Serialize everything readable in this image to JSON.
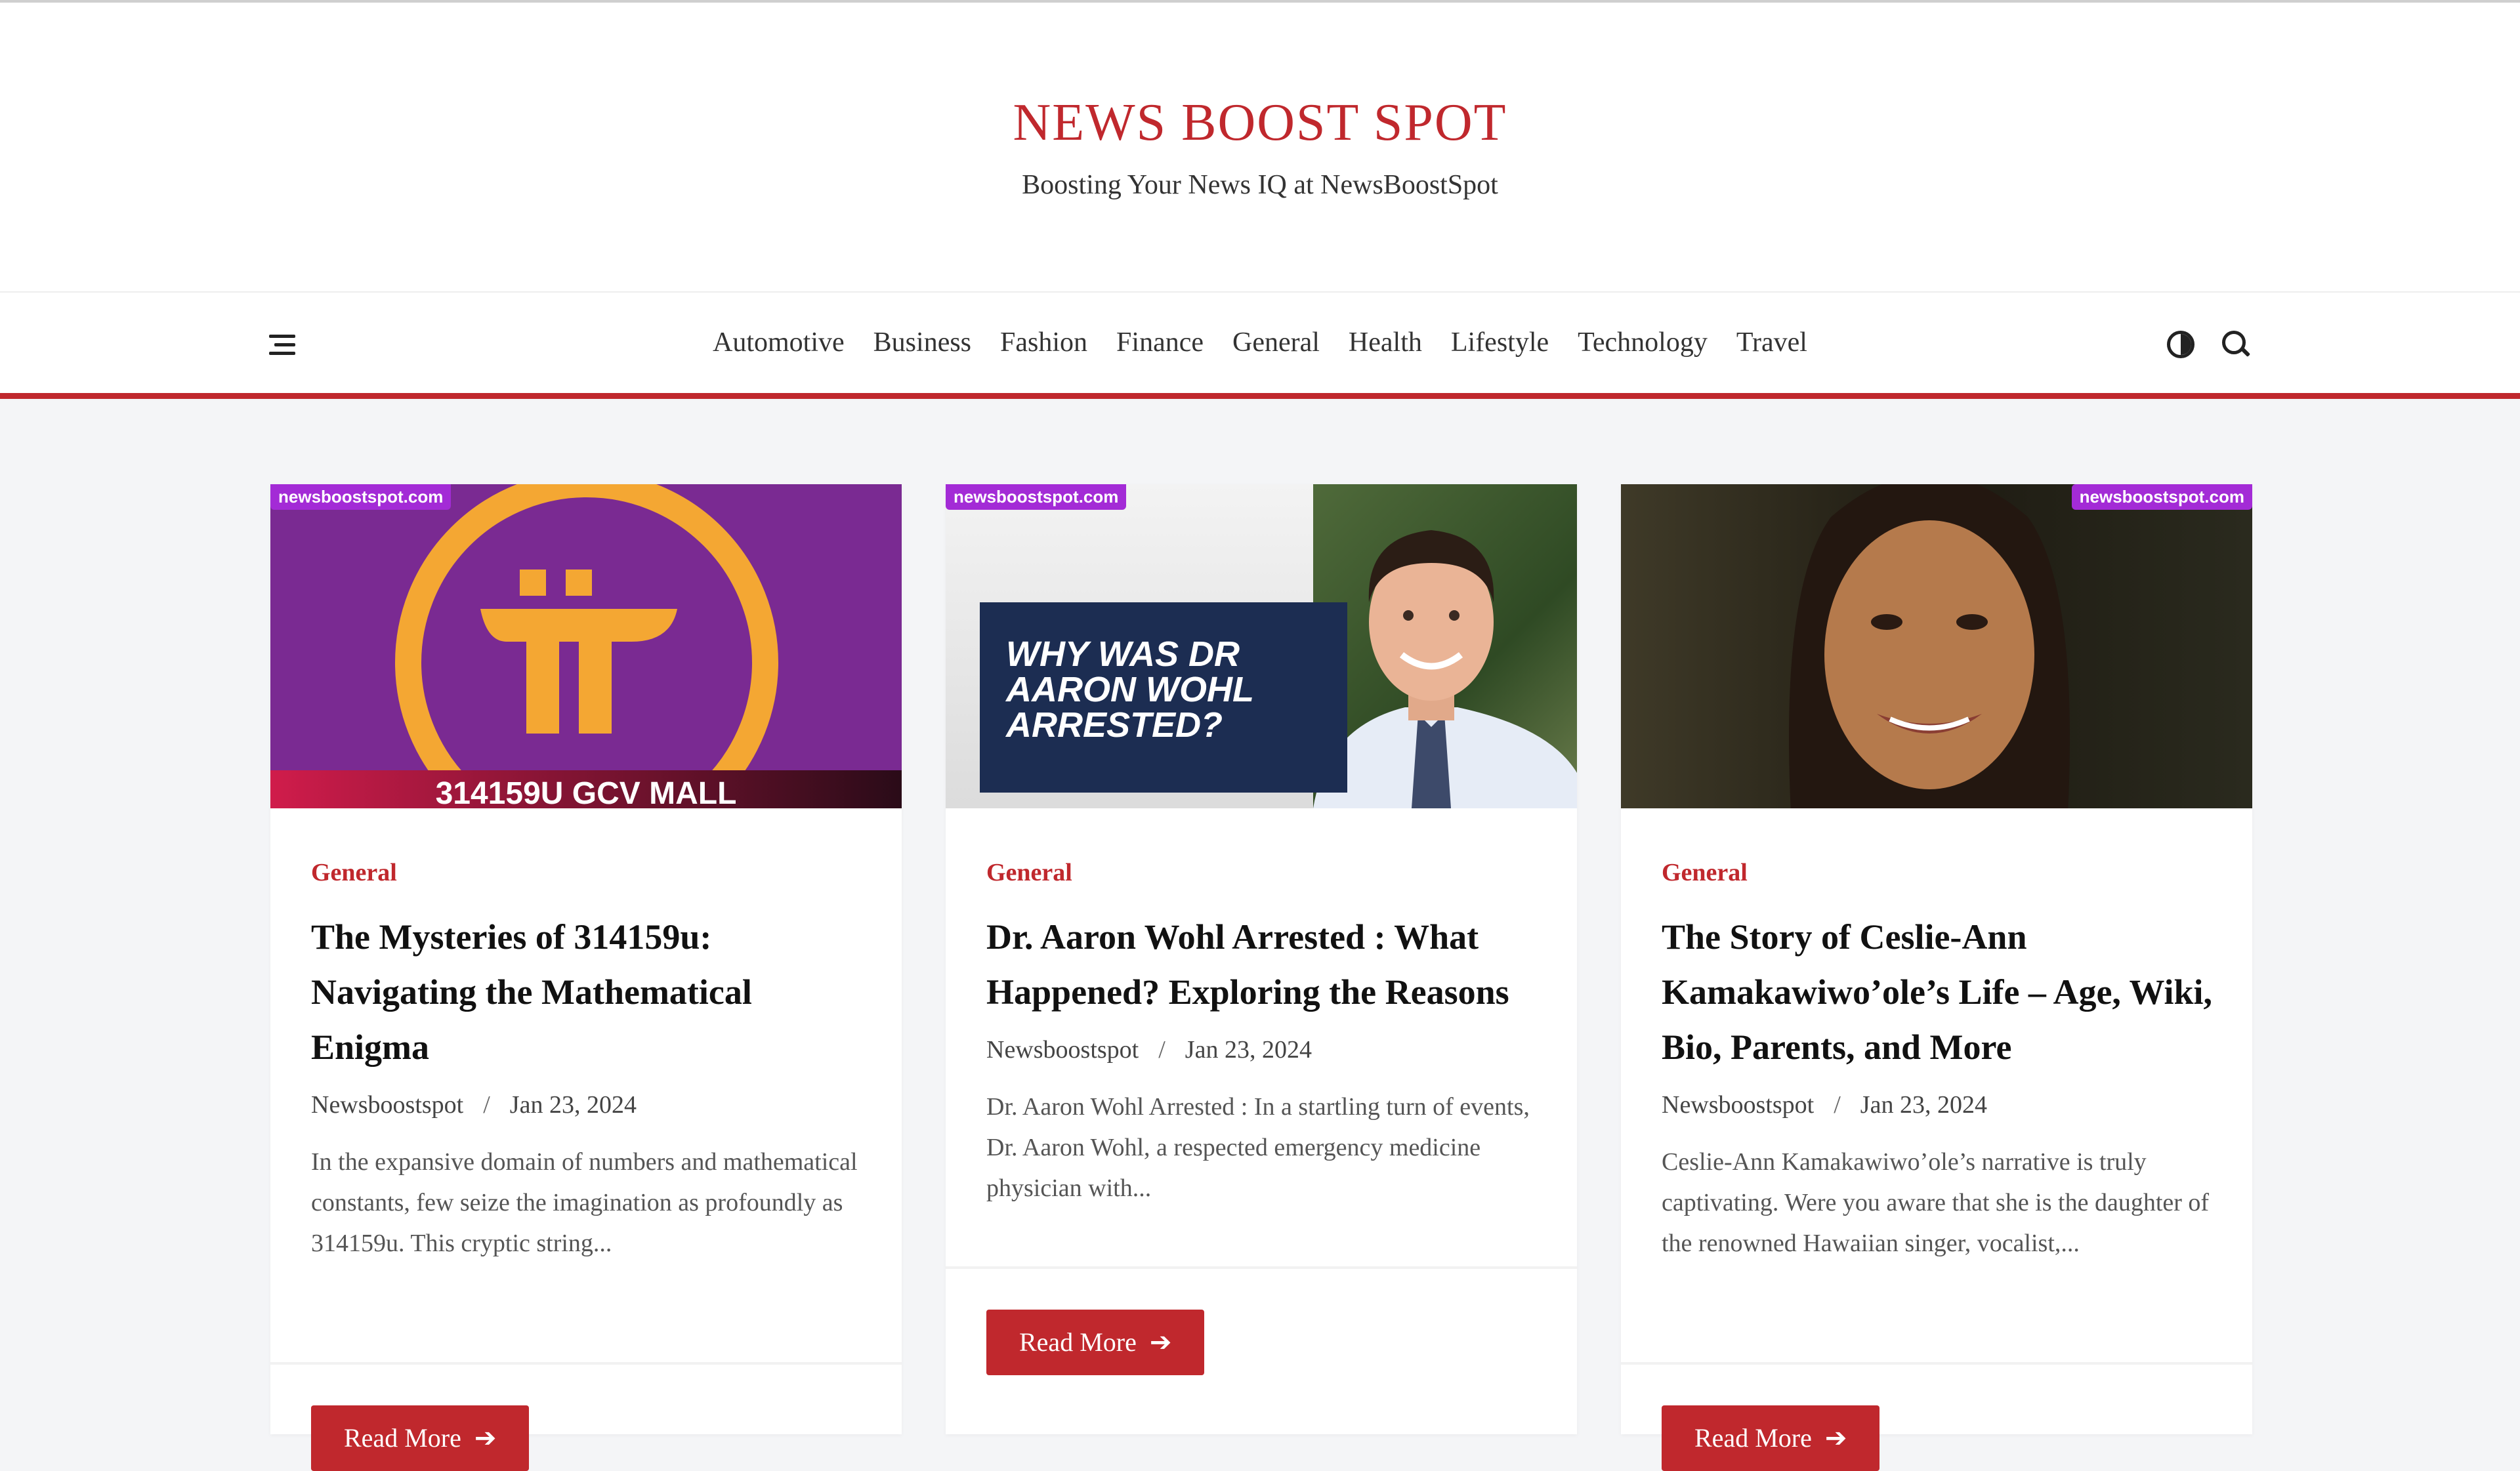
{
  "site": {
    "title": "NEWS BOOST SPOT",
    "tagline": "Boosting Your News IQ at NewsBoostSpot",
    "accent_color": "#c0282d",
    "badge_color": "#a32bd6"
  },
  "nav": {
    "items": [
      "Automotive",
      "Business",
      "Fashion",
      "Finance",
      "General",
      "Health",
      "Lifestyle",
      "Technology",
      "Travel"
    ],
    "icons": {
      "menu": "hamburger-icon",
      "theme": "dark-mode-toggle-icon",
      "search": "search-icon"
    }
  },
  "posts": [
    {
      "badge": "newsboostspot.com",
      "image_caption": "314159U GCV MALL",
      "category": "General",
      "title": "The Mysteries of 314159u: Navigating the Mathematical Enigma",
      "author": "Newsboostspot",
      "date": "Jan 23, 2024",
      "excerpt": "In the expansive domain of numbers and mathematical constants, few seize the imagination as profoundly as 314159u. This cryptic string...",
      "read_more": "Read More"
    },
    {
      "badge": "newsboostspot.com",
      "image_caption": "WHY WAS DR AARON WOHL ARRESTED?",
      "category": "General",
      "title": "Dr. Aaron Wohl Arrested : What Happened? Exploring the Reasons",
      "author": "Newsboostspot",
      "date": "Jan 23, 2024",
      "excerpt": "Dr. Aaron Wohl Arrested : In a startling turn of events, Dr. Aaron Wohl, a respected emergency medicine physician with...",
      "read_more": "Read More"
    },
    {
      "badge": "newsboostspot.com",
      "category": "General",
      "title": "The Story of Ceslie-Ann Kamakawiwo’ole’s Life – Age, Wiki, Bio, Parents, and More",
      "author": "Newsboostspot",
      "date": "Jan 23, 2024",
      "excerpt": "Ceslie-Ann Kamakawiwo’ole’s narrative is truly captivating. Were you aware that she is the daughter of the renowned Hawaiian singer, vocalist,...",
      "read_more": "Read More"
    }
  ]
}
